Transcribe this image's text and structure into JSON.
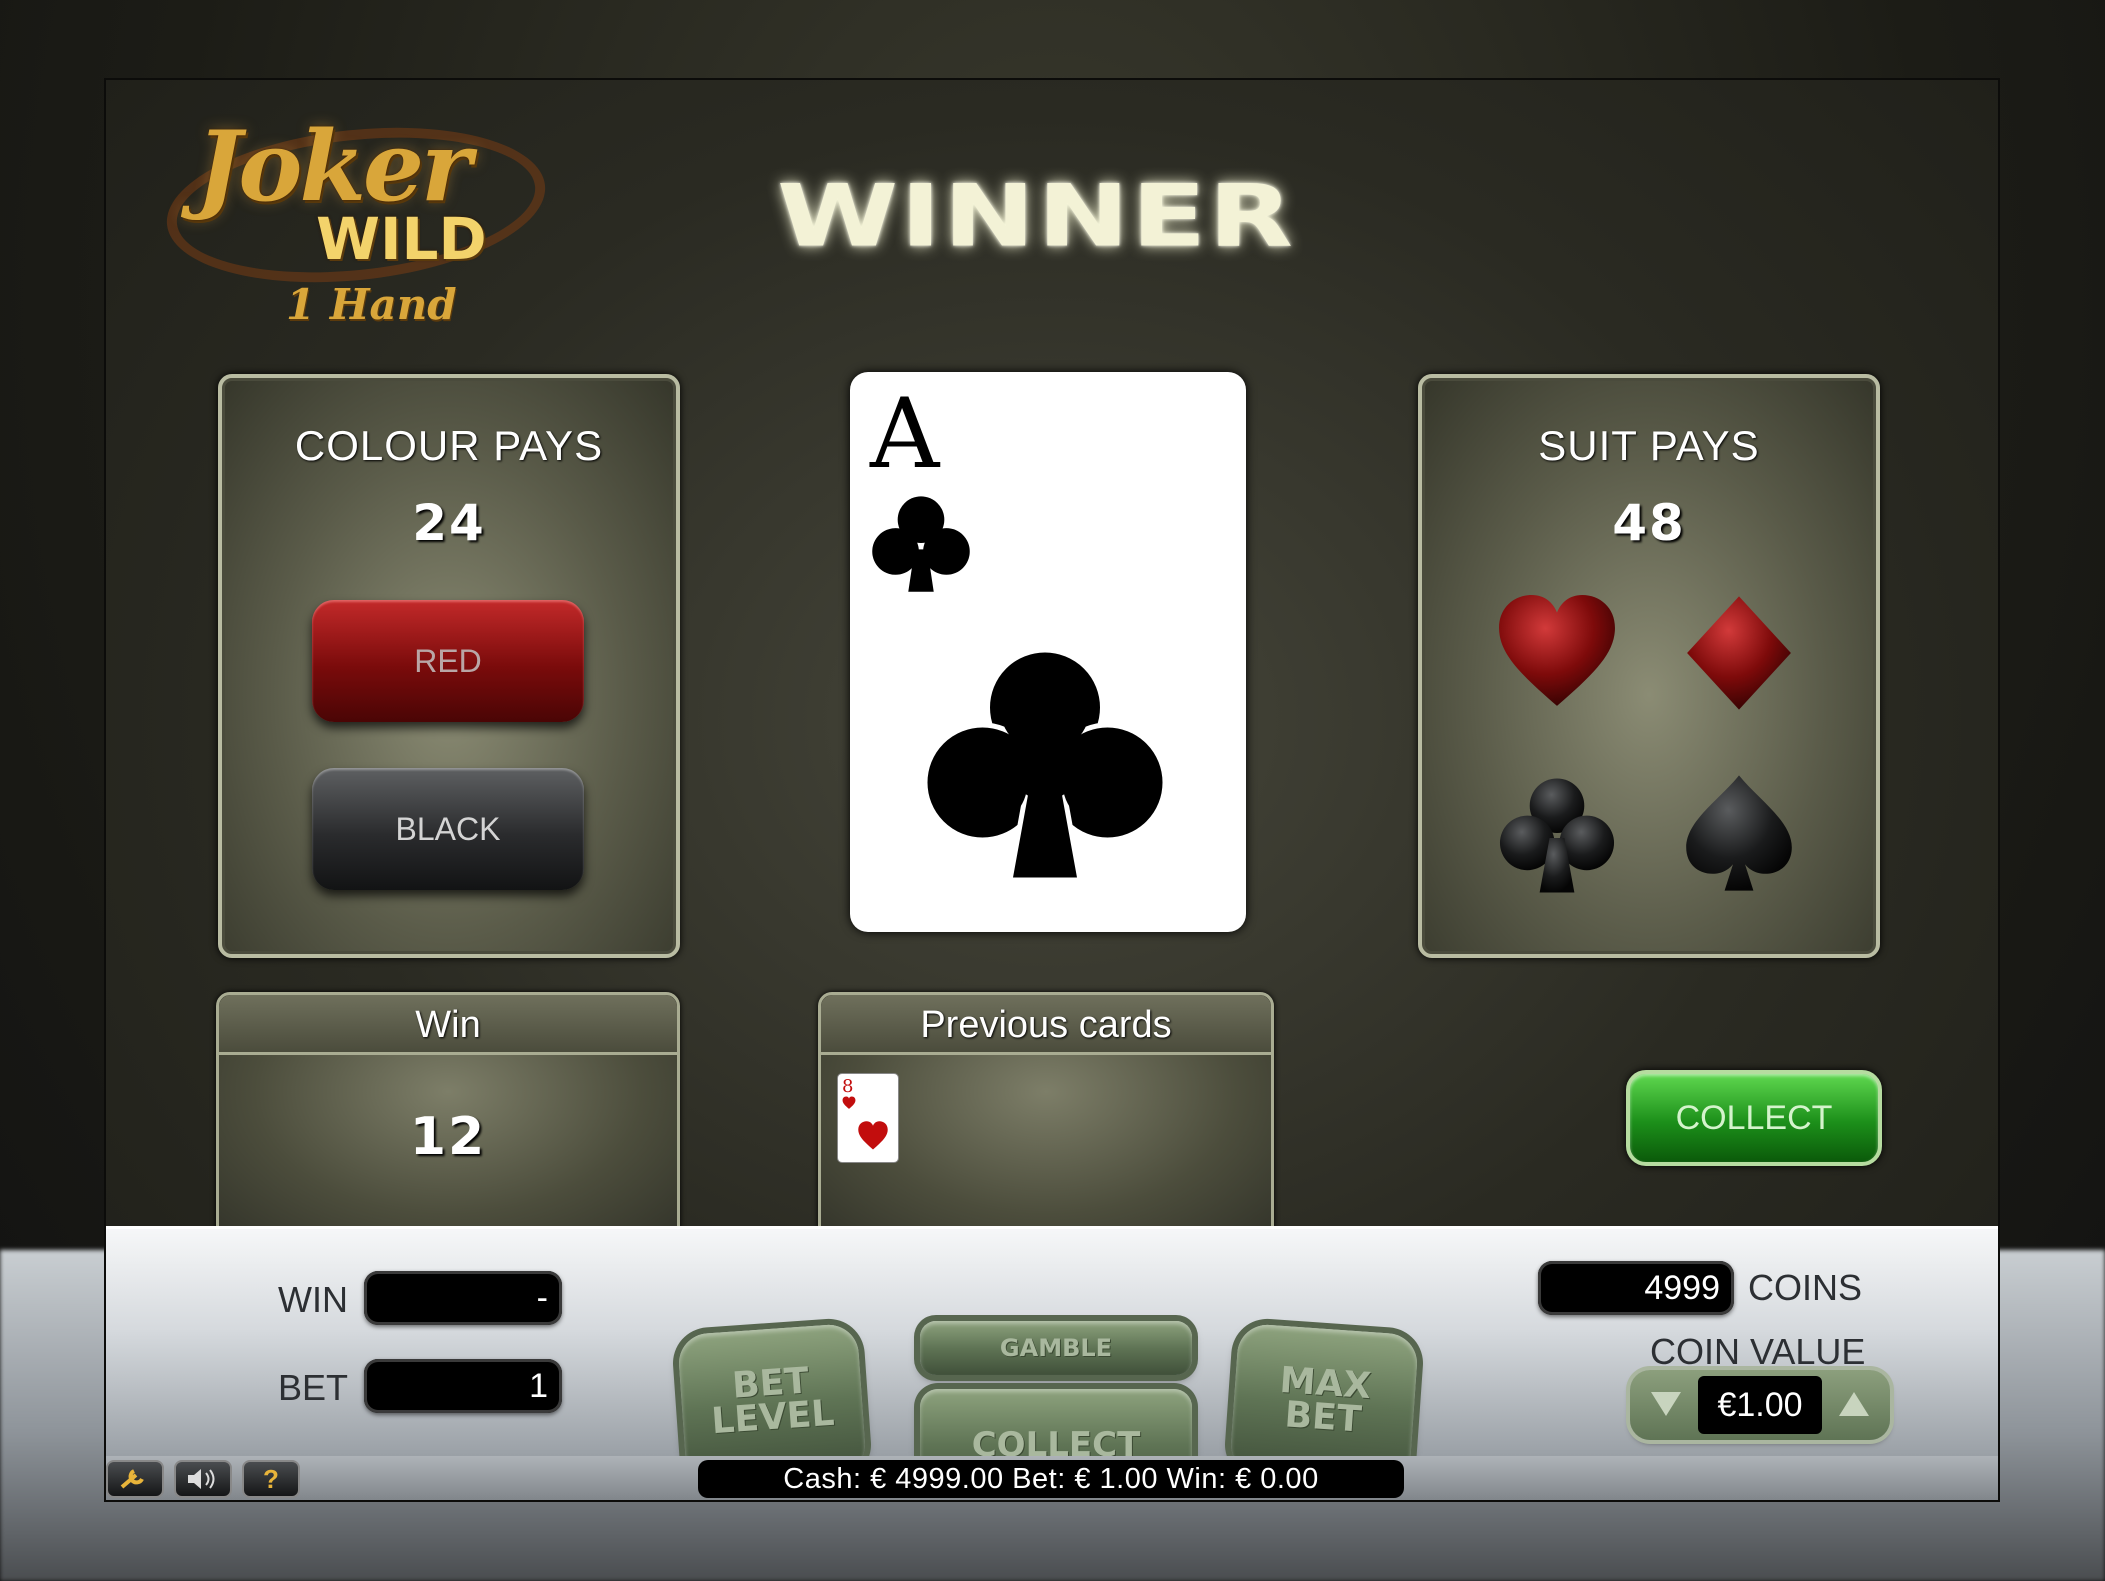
{
  "logo": {
    "line1": "Joker",
    "line2": "WILD",
    "line3": "1 Hand"
  },
  "banner": "WINNER",
  "colour_pays": {
    "title": "COLOUR PAYS",
    "value": "24",
    "red_label": "RED",
    "black_label": "BLACK"
  },
  "suit_pays": {
    "title": "SUIT PAYS",
    "value": "48",
    "suits": [
      "heart-icon",
      "diamond-icon",
      "club-icon",
      "spade-icon"
    ]
  },
  "card": {
    "rank": "A",
    "suit": "club",
    "color": "#000000"
  },
  "win_box": {
    "label": "Win",
    "value": "12"
  },
  "previous": {
    "label": "Previous cards",
    "cards": [
      {
        "rank": "8",
        "suit": "heart",
        "color": "#c20d0d"
      }
    ]
  },
  "collect_top_label": "COLLECT",
  "controls": {
    "win_label": "WIN",
    "win_value": "-",
    "bet_label": "BET",
    "bet_value": "1",
    "bet_level_label_1": "BET",
    "bet_level_label_2": "LEVEL",
    "gamble_label": "GAMBLE",
    "collect_label": "COLLECT",
    "max_bet_label_1": "MAX",
    "max_bet_label_2": "BET",
    "coins_value": "4999",
    "coins_label": "COINS",
    "coin_value_label": "COIN VALUE",
    "coin_value": "€1.00"
  },
  "status": "Cash:  € 4999.00   Bet:  € 1.00   Win:  € 0.00",
  "colors": {
    "accent_green": "#1c8f1a",
    "red_button": "#7a0b0b",
    "panel": "#5a5b49"
  }
}
